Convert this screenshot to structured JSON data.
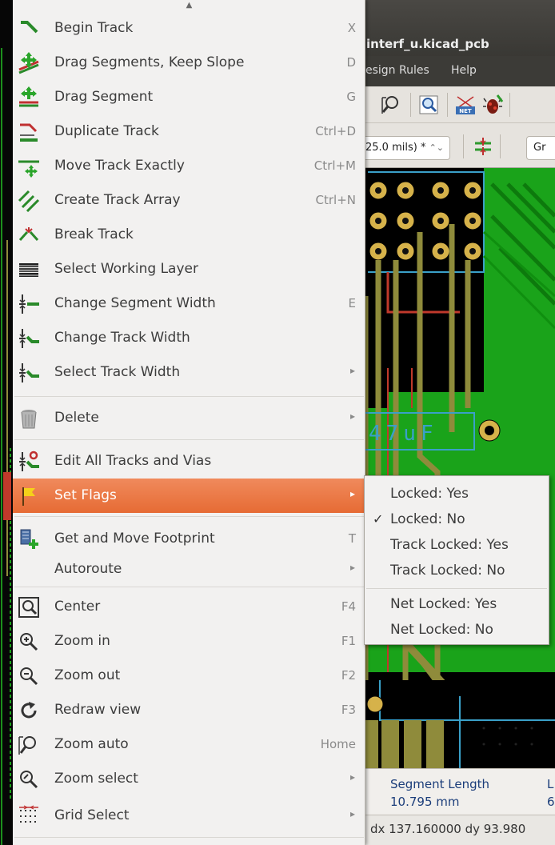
{
  "window": {
    "title": "interf_u.kicad_pcb",
    "menubar": [
      "esign Rules",
      "Help"
    ]
  },
  "toolbar": {
    "via_size": "25.0 mils) *",
    "grid": "Gr"
  },
  "pcb_labels": {
    "cap_label": "47uF"
  },
  "message_panel": {
    "label": "Segment Length",
    "value": "10.795 mm",
    "label2": "L",
    "value2": "6"
  },
  "status": "dx 137.160000  dy 93.980",
  "colors": {
    "highlight": "#e96f3a",
    "pcb_green": "#1aa31a",
    "track_olive": "#8f8b3b",
    "label_blue": "#1b3d7a"
  },
  "menu": {
    "scroll_up_icon": "▲",
    "items": [
      {
        "label": "Begin Track",
        "accel": "X",
        "icon": "begin-track-icon"
      },
      {
        "label": "Drag Segments, Keep Slope",
        "accel": "D",
        "icon": "drag-keep-slope-icon"
      },
      {
        "label": "Drag Segment",
        "accel": "G",
        "icon": "drag-segment-icon"
      },
      {
        "label": "Duplicate Track",
        "accel": "Ctrl+D",
        "icon": "duplicate-track-icon"
      },
      {
        "label": "Move Track Exactly",
        "accel": "Ctrl+M",
        "icon": "move-exact-icon"
      },
      {
        "label": "Create Track Array",
        "accel": "Ctrl+N",
        "icon": "track-array-icon"
      },
      {
        "label": "Break Track",
        "accel": "",
        "icon": "break-track-icon"
      },
      {
        "label": "Select Working Layer",
        "accel": "",
        "icon": "layers-icon"
      },
      {
        "label": "Change Segment Width",
        "accel": "E",
        "icon": "segment-width-icon"
      },
      {
        "label": "Change Track Width",
        "accel": "",
        "icon": "track-width-icon"
      },
      {
        "label": "Select Track Width",
        "accel": "",
        "submenu": true,
        "icon": "select-width-icon"
      },
      {
        "label": "Delete",
        "accel": "",
        "submenu": true,
        "icon": "trash-icon"
      },
      {
        "label": "Edit All Tracks and Vias",
        "accel": "",
        "icon": "edit-tracks-icon"
      },
      {
        "label": "Set Flags",
        "accel": "",
        "submenu": true,
        "highlighted": true,
        "icon": "flag-icon"
      },
      {
        "label": "Get and Move Footprint",
        "accel": "T",
        "icon": "footprint-icon"
      },
      {
        "label": "Autoroute",
        "accel": "",
        "submenu": true,
        "icon": ""
      },
      {
        "label": "Center",
        "accel": "F4",
        "icon": "center-icon"
      },
      {
        "label": "Zoom in",
        "accel": "F1",
        "icon": "zoom-in-icon"
      },
      {
        "label": "Zoom out",
        "accel": "F2",
        "icon": "zoom-out-icon"
      },
      {
        "label": "Redraw view",
        "accel": "F3",
        "icon": "redraw-icon"
      },
      {
        "label": "Zoom auto",
        "accel": "Home",
        "icon": "zoom-auto-icon"
      },
      {
        "label": "Zoom select",
        "accel": "",
        "submenu": true,
        "icon": "zoom-select-icon"
      },
      {
        "label": "Grid Select",
        "accel": "",
        "submenu": true,
        "icon": "grid-icon"
      }
    ]
  },
  "submenu": {
    "items": [
      {
        "label": "Locked: Yes",
        "checked": false
      },
      {
        "label": "Locked: No",
        "checked": true
      },
      {
        "label": "Track Locked: Yes",
        "checked": false
      },
      {
        "label": "Track Locked: No",
        "checked": false
      },
      {
        "label": "Net Locked: Yes",
        "checked": false
      },
      {
        "label": "Net Locked: No",
        "checked": false
      }
    ],
    "check_glyph": "✓"
  }
}
